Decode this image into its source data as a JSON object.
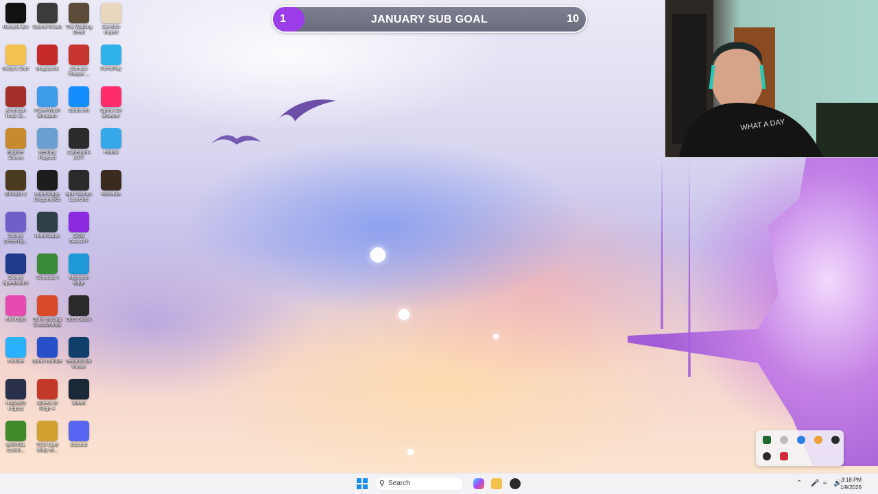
{
  "desktop_icons": [
    {
      "label": "Recycle Bin",
      "icon": "recycle-bin-icon",
      "color": "#111111"
    },
    {
      "label": "Marvel Rivals",
      "icon": "marvel-rivals-icon",
      "color": "#3b3b3b"
    },
    {
      "label": "The Walking Dead",
      "icon": "walking-dead-icon",
      "color": "#5b4d3a"
    },
    {
      "label": "Genshin Impact",
      "icon": "genshin-icon",
      "color": "#e9d6bf"
    },
    {
      "label": "Nicky's Stuff",
      "icon": "folder-icon",
      "color": "#f2c14e"
    },
    {
      "label": "Megabonk",
      "icon": "megabonk-icon",
      "color": "#c42a2a"
    },
    {
      "label": "Ultimate Theater ...",
      "icon": "theater-icon",
      "color": "#c8342e"
    },
    {
      "label": "HoYoPlay",
      "icon": "hoyoplay-icon",
      "color": "#2fb2e8"
    },
    {
      "label": "American Truck Si...",
      "icon": "truck-icon",
      "color": "#a33028"
    },
    {
      "label": "PowerWash Simulator",
      "icon": "powerwash-icon",
      "color": "#3d9be9"
    },
    {
      "label": "Battle.net",
      "icon": "battlenet-icon",
      "color": "#148eff"
    },
    {
      "label": "Opera GX Browser",
      "icon": "opera-icon",
      "color": "#ff2d6b"
    },
    {
      "label": "Brighter Shores",
      "icon": "brighter-shores-icon",
      "color": "#c98a2d"
    },
    {
      "label": "Restbay Playtest",
      "icon": "restbay-icon",
      "color": "#6aa0d0"
    },
    {
      "label": "Cyberpunk 2077",
      "icon": "cyberpunk-icon",
      "color": "#2b2b2b"
    },
    {
      "label": "Paltalk",
      "icon": "paltalk-icon",
      "color": "#36a8e8"
    },
    {
      "label": "Chivalry 2",
      "icon": "chivalry-icon",
      "color": "#4a3b20"
    },
    {
      "label": "RuneScape Dragonwilds",
      "icon": "runescape-dw-icon",
      "color": "#1c1c1c"
    },
    {
      "label": "Epic Games Launcher",
      "icon": "epic-icon",
      "color": "#2a2a2a"
    },
    {
      "label": "RuneLite",
      "icon": "runelite-icon",
      "color": "#3a2a20"
    },
    {
      "label": "Disney Dreamlig...",
      "icon": "disney-icon",
      "color": "#6f5fc9"
    },
    {
      "label": "RuneScape",
      "icon": "runescape-icon",
      "color": "#2f3f46"
    },
    {
      "label": "GOG GALAXY",
      "icon": "gog-icon",
      "color": "#8a2be2"
    },
    {
      "label": "",
      "icon": "empty",
      "color": "transparent"
    },
    {
      "label": "Disney Speedstorm",
      "icon": "speedstorm-icon",
      "color": "#1e3a8a"
    },
    {
      "label": "Schedule I",
      "icon": "schedule-icon",
      "color": "#3a8a3a"
    },
    {
      "label": "Microsoft Edge",
      "icon": "edge-icon",
      "color": "#1b9ad6"
    },
    {
      "label": "",
      "icon": "empty",
      "color": "transparent"
    },
    {
      "label": "Fall Guys",
      "icon": "fallguys-icon",
      "color": "#e84bb0"
    },
    {
      "label": "Sonic Racing CrossWorlds",
      "icon": "sonic-racing-icon",
      "color": "#d84a2a"
    },
    {
      "label": "OBS Studio",
      "icon": "obs-icon",
      "color": "#2a2a2a"
    },
    {
      "label": "",
      "icon": "empty",
      "color": "transparent"
    },
    {
      "label": "Fortnite",
      "icon": "fortnite-icon",
      "color": "#2bb0ff"
    },
    {
      "label": "Sonic Rumble",
      "icon": "sonic-rumble-icon",
      "color": "#2850c8"
    },
    {
      "label": "Second Life Viewer",
      "icon": "second-life-icon",
      "color": "#0f3f6a"
    },
    {
      "label": "",
      "icon": "empty",
      "color": "transparent"
    },
    {
      "label": "Hogwarts Legacy",
      "icon": "hogwarts-icon",
      "color": "#2a2f4a"
    },
    {
      "label": "Streets of Rage 4",
      "icon": "sor4-icon",
      "color": "#c43a2a"
    },
    {
      "label": "Steam",
      "icon": "steam-icon",
      "color": "#1b2838"
    },
    {
      "label": "",
      "icon": "empty",
      "color": "transparent"
    },
    {
      "label": "MARVEL Cosmi...",
      "icon": "marvel-cosmic-icon",
      "color": "#3f8a2a"
    },
    {
      "label": "TCG Card Shop Si...",
      "icon": "tcg-icon",
      "color": "#d0a030"
    },
    {
      "label": "Discord",
      "icon": "discord-icon",
      "color": "#5865f2"
    }
  ],
  "sub_goal": {
    "start": "1",
    "title": "JANUARY SUB GOAL",
    "end": "10",
    "progress_fraction": 0.1,
    "fill_color": "#9b3ee8"
  },
  "taskbar": {
    "search_placeholder": "Search",
    "time": "3:18 PM",
    "date": "1/9/2026"
  }
}
